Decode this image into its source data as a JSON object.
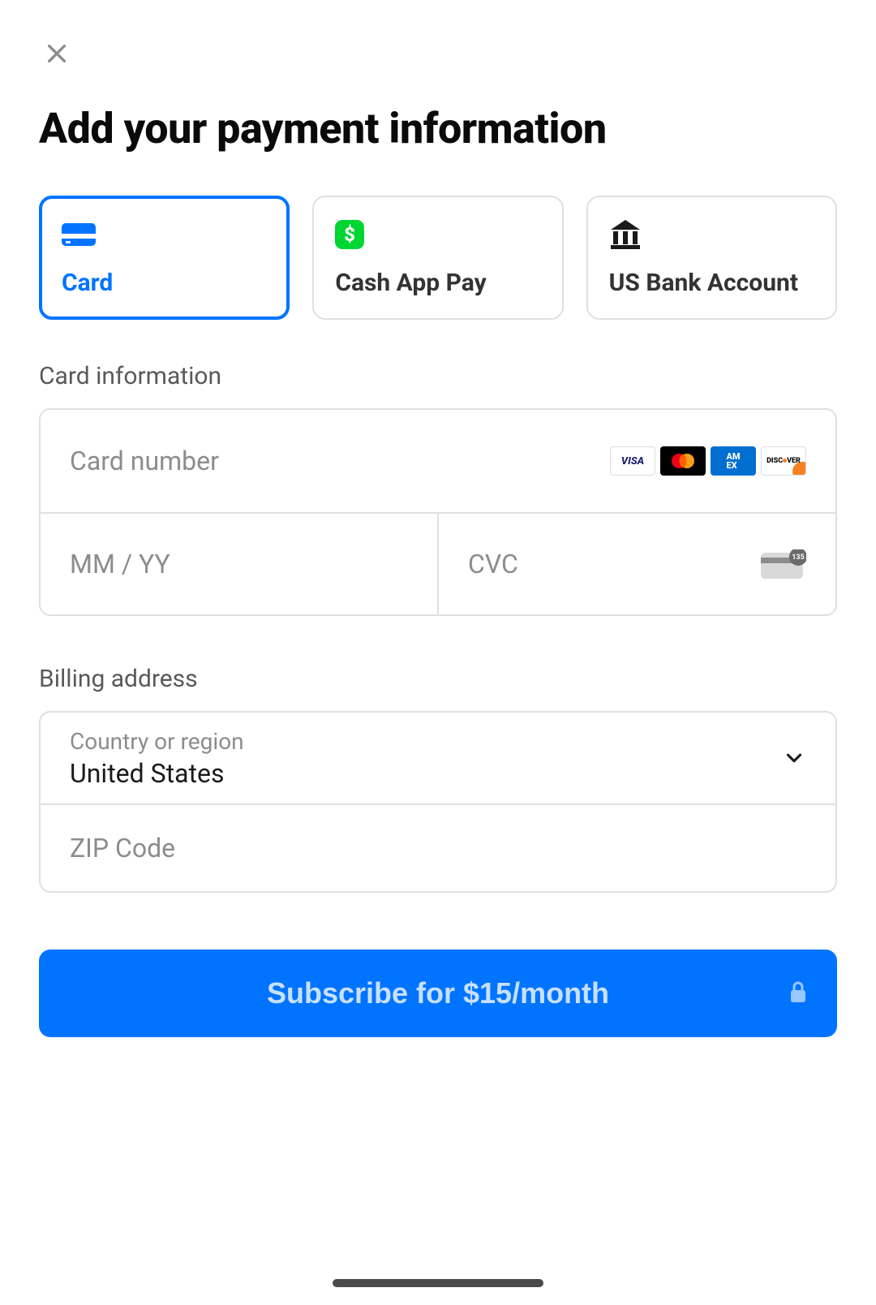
{
  "title": "Add your payment information",
  "payment_methods": {
    "card_label": "Card",
    "cashapp_label": "Cash App Pay",
    "bank_label": "US Bank Account"
  },
  "card_section": {
    "label": "Card information",
    "number_placeholder": "Card number",
    "expiry_placeholder": "MM / YY",
    "cvc_placeholder": "CVC",
    "brands": {
      "visa": "VISA",
      "mastercard": "mastercard",
      "amex": "AMEX",
      "discover": "DISCOVER"
    }
  },
  "billing": {
    "label": "Billing address",
    "country_label": "Country or region",
    "country_value": "United States",
    "zip_placeholder": "ZIP Code"
  },
  "subscribe_label": "Subscribe for $15/month",
  "colors": {
    "primary": "#0074ff",
    "cashapp_green": "#00d632"
  }
}
